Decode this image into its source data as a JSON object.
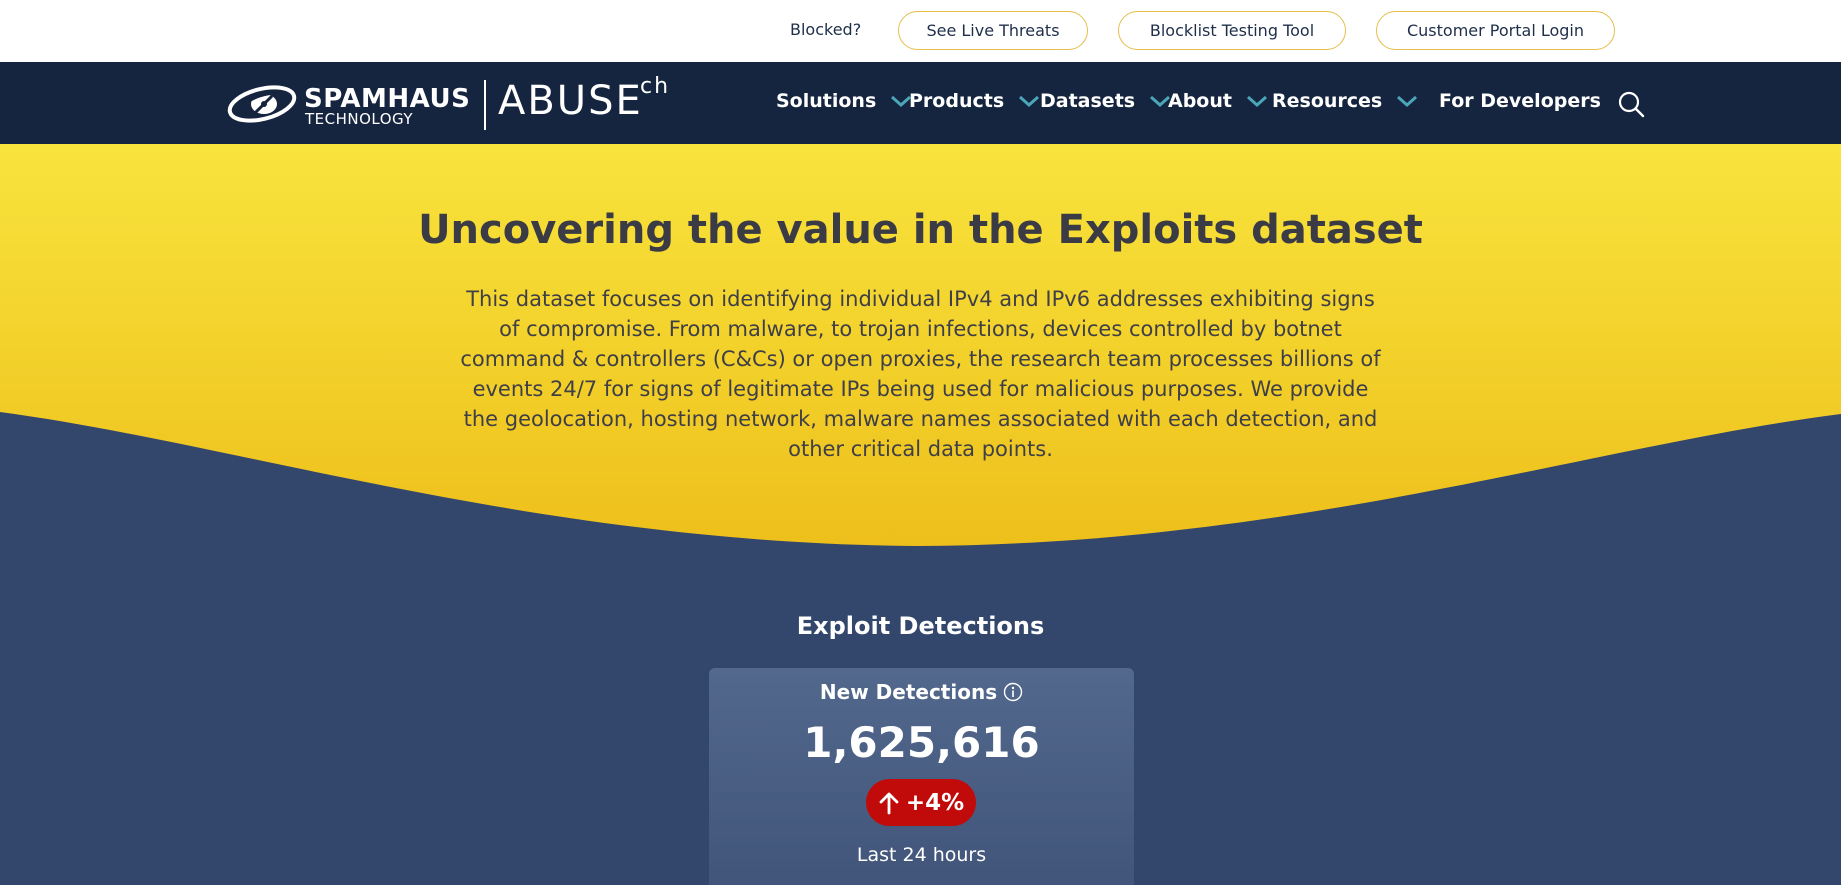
{
  "topbar": {
    "blocked": "Blocked?",
    "live_threats": "See Live Threats",
    "blocklist_tool": "Blocklist Testing Tool",
    "portal_login": "Customer Portal Login"
  },
  "logo": {
    "brand": "SPAMHAUS",
    "brand_sub": "TECHNOLOGY",
    "abuse": "ABUSE",
    "abuse_suffix": "ch"
  },
  "nav": {
    "items": [
      {
        "label": "Solutions",
        "icon": "chevron-down-icon"
      },
      {
        "label": "Products",
        "icon": "chevron-down-icon"
      },
      {
        "label": "Datasets",
        "icon": "chevron-down-icon"
      },
      {
        "label": "About",
        "icon": "chevron-down-icon"
      },
      {
        "label": "Resources",
        "icon": "chevron-down-icon"
      }
    ],
    "developers": "For Developers",
    "search_icon": "search-icon"
  },
  "hero": {
    "title": "Uncovering the value in the Exploits dataset",
    "description": "This dataset focuses on identifying individual IPv4 and IPv6 addresses exhibiting signs of compromise. From malware, to trojan infections, devices controlled by botnet command & controllers (C&Cs) or open proxies, the research team processes billions of events 24/7 for signs of legitimate IPs being used for malicious purposes. We provide the geolocation, hosting network, malware names associated with each detection, and other critical data points."
  },
  "detections": {
    "section_title": "Exploit Detections",
    "card_label": "New Detections",
    "value": "1,625,616",
    "change": "+4%",
    "period": "Last 24 hours",
    "change_icon": "arrow-up-icon",
    "info_icon": "info-icon"
  },
  "colors": {
    "nav_bg": "#16253f",
    "page_bg": "#33476c",
    "hero_yellow": "#f7e03a",
    "accent_teal": "#4aa6b8",
    "pill_border": "#e4be4b",
    "badge_red": "#c10b0b"
  }
}
